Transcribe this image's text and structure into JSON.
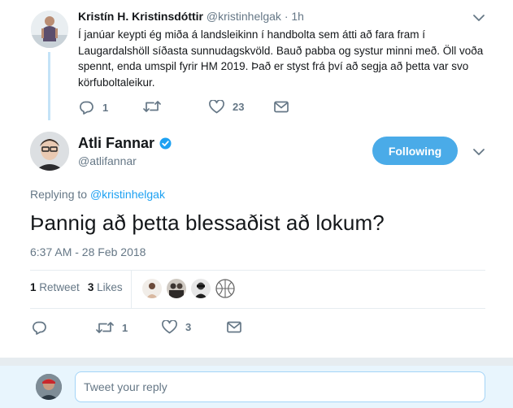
{
  "parent_tweet": {
    "author_name": "Kristín H. Kristinsdóttir",
    "author_handle": "@kristinhelgak",
    "time": "· 1h",
    "text": "Í janúar keypti ég miða á landsleikinn í handbolta sem átti að fara fram í Laugardalshöll síðasta sunnudagskvöld. Bauð pabba og systur minni með. Öll voða spennt, enda umspil fyrir HM 2019. Það er styst frá því að segja að þetta var svo körfuboltaleikur.",
    "reply_count": "1",
    "retweet_count": "",
    "like_count": "23"
  },
  "main_tweet": {
    "author_name": "Atli Fannar",
    "author_handle": "@atlifannar",
    "follow_label": "Following",
    "replying_prefix": "Replying to ",
    "replying_to": "@kristinhelgak",
    "text": "Þannig að þetta blessaðist að lokum?",
    "timestamp": "6:37 AM - 28 Feb 2018",
    "retweets_num": "1",
    "retweets_label": "Retweet",
    "likes_num": "3",
    "likes_label": "Likes",
    "reply_count": "",
    "retweet_count": "1",
    "like_count": "3"
  },
  "reply_box": {
    "placeholder": "Tweet your reply"
  },
  "colors": {
    "accent": "#1da1f2",
    "follow_button": "#4aabe8",
    "muted_text": "#657786",
    "divider": "#e6ecf0",
    "reply_bar": "#e8f5fd"
  },
  "icons": [
    "reply-icon",
    "retweet-icon",
    "heart-icon",
    "message-icon",
    "chevron-down-icon",
    "verified-badge-icon"
  ]
}
